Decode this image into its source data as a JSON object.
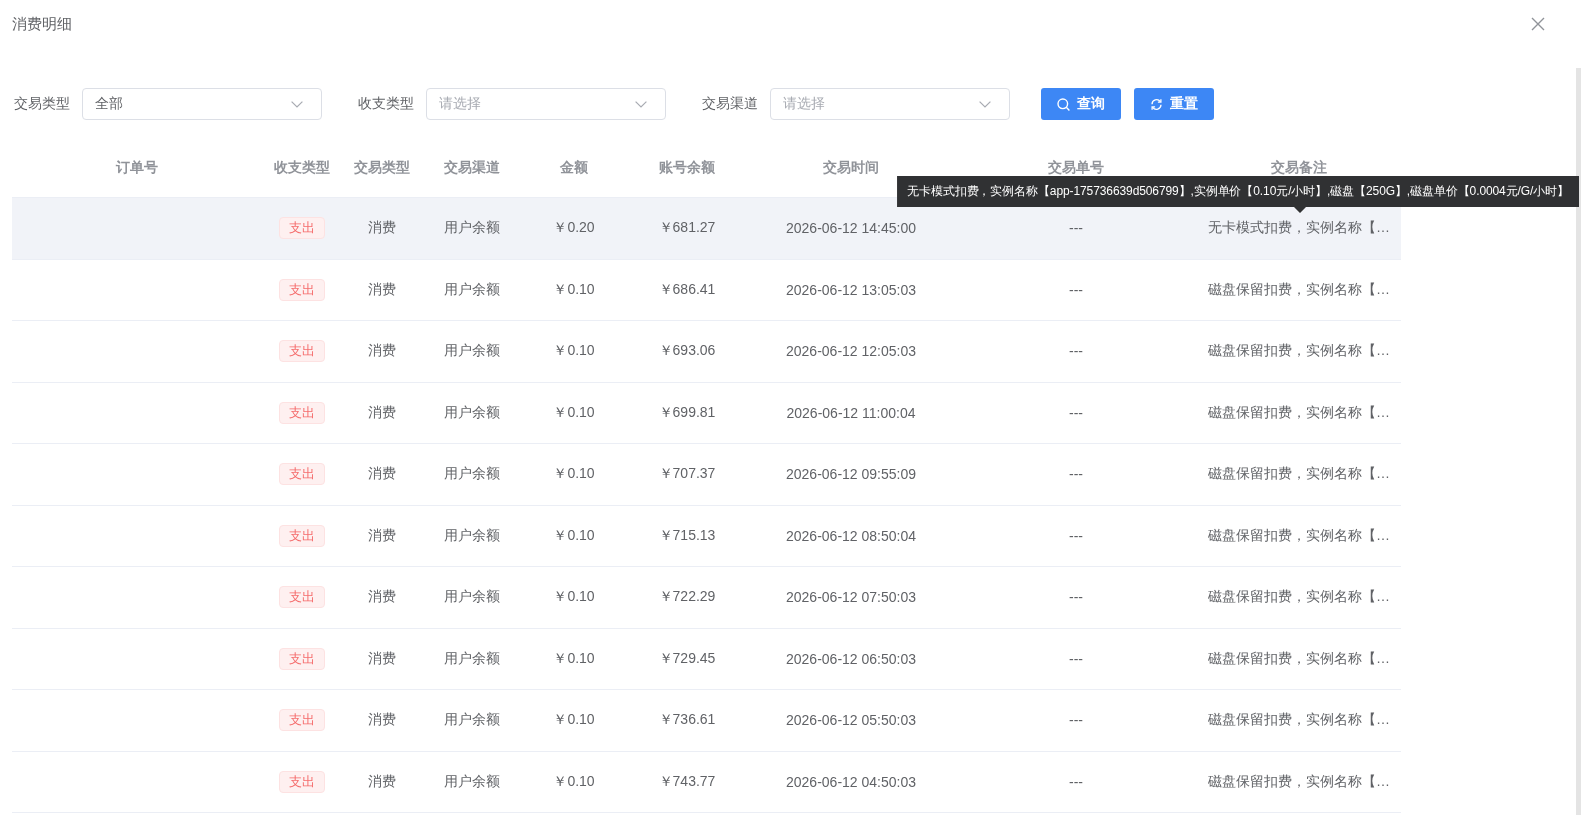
{
  "dialog": {
    "title": "消费明细"
  },
  "filters": [
    {
      "label": "交易类型",
      "value": "全部"
    },
    {
      "label": "收支类型",
      "placeholder": "请选择"
    },
    {
      "label": "交易渠道",
      "placeholder": "请选择"
    }
  ],
  "buttons": [
    {
      "kind": "search",
      "label": "查询"
    },
    {
      "kind": "reset",
      "label": "重置"
    }
  ],
  "table": {
    "columns": [
      "订单号",
      "收支类型",
      "交易类型",
      "交易渠道",
      "金额",
      "账号余额",
      "交易时间",
      "交易单号",
      "交易备注"
    ],
    "rows": [
      {
        "hovered": true,
        "direction": "支出",
        "type": "消费",
        "channel": "用户余额",
        "amount": "￥0.20",
        "balance": "￥681.27",
        "time": "2026-06-12 14:45:00",
        "trade_no": "---",
        "remark": "无卡模式扣费，实例名称【…"
      },
      {
        "hovered": false,
        "direction": "支出",
        "type": "消费",
        "channel": "用户余额",
        "amount": "￥0.10",
        "balance": "￥686.41",
        "time": "2026-06-12 13:05:03",
        "trade_no": "---",
        "remark": "磁盘保留扣费，实例名称【…"
      },
      {
        "hovered": false,
        "direction": "支出",
        "type": "消费",
        "channel": "用户余额",
        "amount": "￥0.10",
        "balance": "￥693.06",
        "time": "2026-06-12 12:05:03",
        "trade_no": "---",
        "remark": "磁盘保留扣费，实例名称【…"
      },
      {
        "hovered": false,
        "direction": "支出",
        "type": "消费",
        "channel": "用户余额",
        "amount": "￥0.10",
        "balance": "￥699.81",
        "time": "2026-06-12 11:00:04",
        "trade_no": "---",
        "remark": "磁盘保留扣费，实例名称【…"
      },
      {
        "hovered": false,
        "direction": "支出",
        "type": "消费",
        "channel": "用户余额",
        "amount": "￥0.10",
        "balance": "￥707.37",
        "time": "2026-06-12 09:55:09",
        "trade_no": "---",
        "remark": "磁盘保留扣费，实例名称【…"
      },
      {
        "hovered": false,
        "direction": "支出",
        "type": "消费",
        "channel": "用户余额",
        "amount": "￥0.10",
        "balance": "￥715.13",
        "time": "2026-06-12 08:50:04",
        "trade_no": "---",
        "remark": "磁盘保留扣费，实例名称【…"
      },
      {
        "hovered": false,
        "direction": "支出",
        "type": "消费",
        "channel": "用户余额",
        "amount": "￥0.10",
        "balance": "￥722.29",
        "time": "2026-06-12 07:50:03",
        "trade_no": "---",
        "remark": "磁盘保留扣费，实例名称【…"
      },
      {
        "hovered": false,
        "direction": "支出",
        "type": "消费",
        "channel": "用户余额",
        "amount": "￥0.10",
        "balance": "￥729.45",
        "time": "2026-06-12 06:50:03",
        "trade_no": "---",
        "remark": "磁盘保留扣费，实例名称【…"
      },
      {
        "hovered": false,
        "direction": "支出",
        "type": "消费",
        "channel": "用户余额",
        "amount": "￥0.10",
        "balance": "￥736.61",
        "time": "2026-06-12 05:50:03",
        "trade_no": "---",
        "remark": "磁盘保留扣费，实例名称【…"
      },
      {
        "hovered": false,
        "direction": "支出",
        "type": "消费",
        "channel": "用户余额",
        "amount": "￥0.10",
        "balance": "￥743.77",
        "time": "2026-06-12 04:50:03",
        "trade_no": "---",
        "remark": "磁盘保留扣费，实例名称【…"
      }
    ]
  },
  "tooltip": {
    "text": "无卡模式扣费，实例名称【app-175736639d506799】,实例单价【0.10元/小时】,磁盘【250G】,磁盘单价【0.0004元/G/小时】"
  }
}
